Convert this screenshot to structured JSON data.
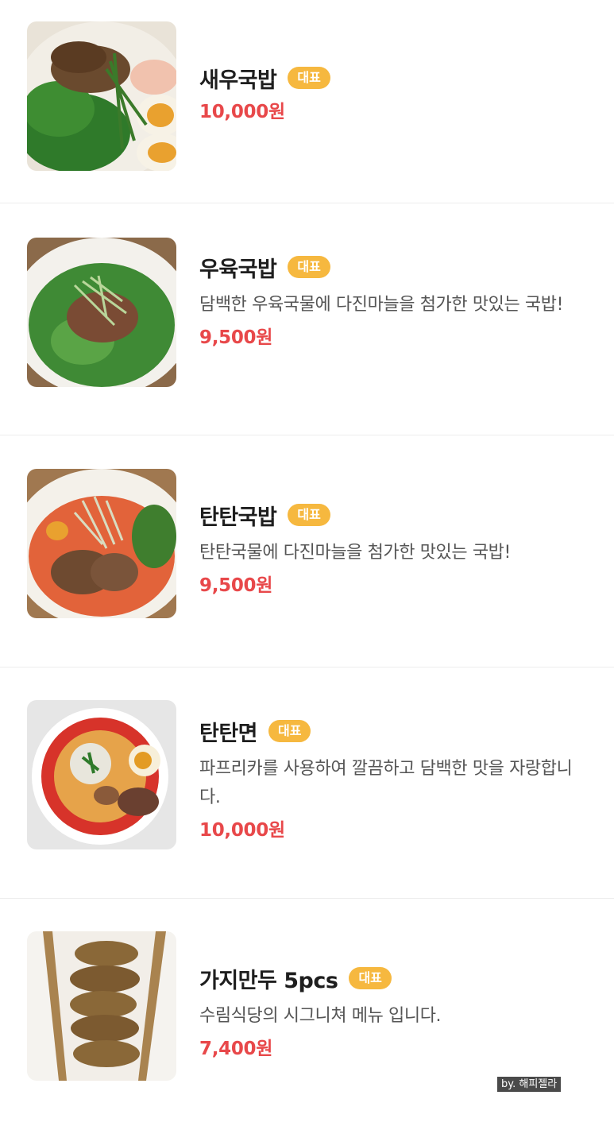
{
  "menu": {
    "items": [
      {
        "name": "새우국밥",
        "badge": "대표",
        "description": "",
        "price": "10,000원",
        "image": "shrimp-gukbap-photo"
      },
      {
        "name": "우육국밥",
        "badge": "대표",
        "description": "담백한 우육국물에 다진마늘을 첨가한 맛있는 국밥!",
        "price": "9,500원",
        "image": "beef-gukbap-photo"
      },
      {
        "name": "탄탄국밥",
        "badge": "대표",
        "description": "탄탄국물에 다진마늘을 첨가한 맛있는 국밥!",
        "price": "9,500원",
        "image": "tantan-gukbap-photo"
      },
      {
        "name": "탄탄면",
        "badge": "대표",
        "description": "파프리카를 사용하여 깔끔하고 담백한 맛을 자랑합니다.",
        "price": "10,000원",
        "image": "tantanmyeon-photo"
      },
      {
        "name": "가지만두 5pcs",
        "badge": "대표",
        "description": "수림식당의 시그니쳐 메뉴 입니다.",
        "price": "7,400원",
        "image": "eggplant-dumpling-photo"
      }
    ]
  },
  "watermark": "by. 해피젤라",
  "colors": {
    "badge": "#f6b83f",
    "price": "#e8484a",
    "divider": "#ececec"
  }
}
